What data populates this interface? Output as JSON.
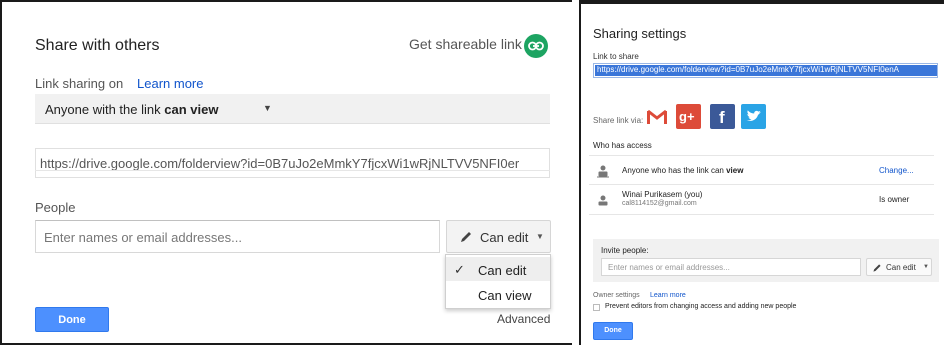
{
  "left": {
    "title": "Share with others",
    "get_link_label": "Get shareable link",
    "link_sharing_label": "Link sharing on",
    "learn_more": "Learn more",
    "access_prefix": "Anyone with the link",
    "access_level": "can view",
    "url": "https://drive.google.com/folderview?id=0B7uJo2eMmkY7fjcxWi1wRjNLTVV5NFI0er",
    "people_label": "People",
    "people_placeholder": "Enter names or email addresses...",
    "permission_button": "Can edit",
    "permission_options": [
      "Can edit",
      "Can view"
    ],
    "permission_selected": "Can edit",
    "done_label": "Done",
    "advanced_label": "Advanced"
  },
  "right": {
    "title": "Sharing settings",
    "link_to_share_label": "Link to share",
    "url": "https://drive.google.com/folderview?id=0B7uJo2eMmkY7fjcxWi1wRjNLTVV5NFI0enA",
    "share_via_label": "Share link via:",
    "gplus_label": "g+",
    "facebook_label": "f",
    "who_has_access_label": "Who has access",
    "access_rows": [
      {
        "text_prefix": "Anyone who has the link can",
        "text_bold": "view",
        "action": "Change..."
      },
      {
        "name": "Winai Purikasem (you)",
        "email": "cal8114152@gmail.com",
        "role": "Is owner"
      }
    ],
    "invite_label": "Invite people:",
    "invite_placeholder": "Enter names or email addresses...",
    "permission_button": "Can edit",
    "owner_settings_label": "Owner settings",
    "learn_more": "Learn more",
    "prevent_editors_label": "Prevent editors from changing access and adding new people",
    "prevent_editors_checked": false,
    "done_label": "Done"
  },
  "colors": {
    "accent_blue": "#4d90fe",
    "link_blue": "#1155cc",
    "link_icon_green": "#1da462",
    "gmail_red": "#dd4b39",
    "facebook_blue": "#3b5998",
    "twitter_blue": "#2aa4e6"
  },
  "icons": [
    "link-icon",
    "pencil-icon",
    "checkmark-icon",
    "gmail-icon",
    "google-plus-icon",
    "facebook-icon",
    "twitter-icon",
    "globe-person-icon",
    "person-icon",
    "chevron-down-icon"
  ]
}
